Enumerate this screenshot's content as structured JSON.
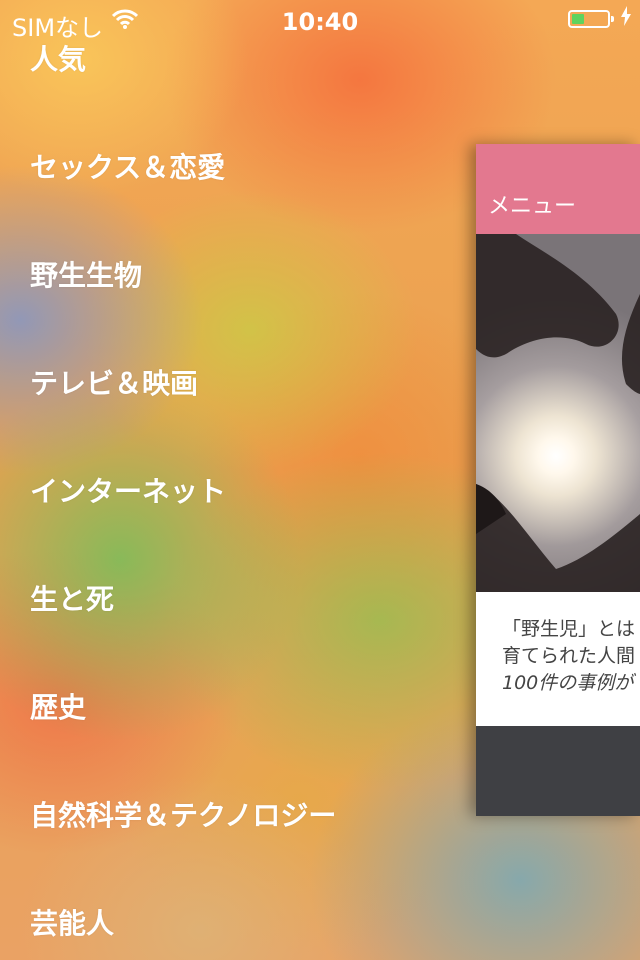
{
  "status_bar": {
    "carrier": "SIMなし",
    "time": "10:40",
    "battery_level": 0.35
  },
  "menu": {
    "items": [
      {
        "label": "人気"
      },
      {
        "label": "セックス＆恋愛"
      },
      {
        "label": "野生生物"
      },
      {
        "label": "テレビ＆映画"
      },
      {
        "label": "インターネット"
      },
      {
        "label": "生と死"
      },
      {
        "label": "歴史"
      },
      {
        "label": "自然科学＆テクノロジー"
      },
      {
        "label": "芸能人"
      }
    ]
  },
  "panel": {
    "title": "メニュー",
    "article_lines": [
      "「野生児」とは",
      "育てられた人間",
      "100件の事例が"
    ]
  },
  "colors": {
    "header_pink": "#e3788f",
    "footer_dark": "#3f4044"
  }
}
